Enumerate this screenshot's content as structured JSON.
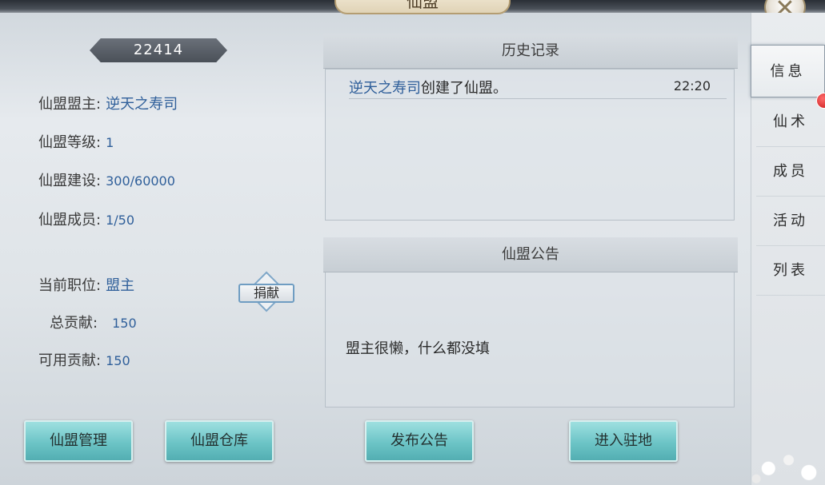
{
  "window": {
    "title": "仙盟"
  },
  "left": {
    "alliance_id": "22414",
    "rows": [
      {
        "label": "仙盟盟主:",
        "value": "逆天之寿司"
      },
      {
        "label": "仙盟等级:",
        "value": "1"
      },
      {
        "label": "仙盟建设:",
        "value": "300/60000"
      },
      {
        "label": "仙盟成员:",
        "value": "1/50"
      },
      {
        "label": "当前职位:",
        "value": "盟主"
      },
      {
        "label": "总贡献:",
        "value": "150"
      },
      {
        "label": "可用贡献:",
        "value": "150"
      }
    ],
    "donate_label": "捐献"
  },
  "history": {
    "header": "历史记录",
    "entries": [
      {
        "who": "逆天之寿司",
        "what": "创建了仙盟。",
        "time": "22:20"
      }
    ]
  },
  "notice": {
    "header": "仙盟公告",
    "text": "盟主很懒，什么都没填"
  },
  "tabs": [
    {
      "label": "信息",
      "active": true
    },
    {
      "label": "仙术"
    },
    {
      "label": "成员"
    },
    {
      "label": "活动"
    },
    {
      "label": "列表"
    }
  ],
  "buttons": {
    "manage": "仙盟管理",
    "warehouse": "仙盟仓库",
    "publish": "发布公告",
    "enter": "进入驻地"
  },
  "close_icon": "close-icon",
  "colors": {
    "accent_blue": "#2f5f9a",
    "button_teal": "#6cc4c6",
    "badge_red": "#c81b1b"
  }
}
